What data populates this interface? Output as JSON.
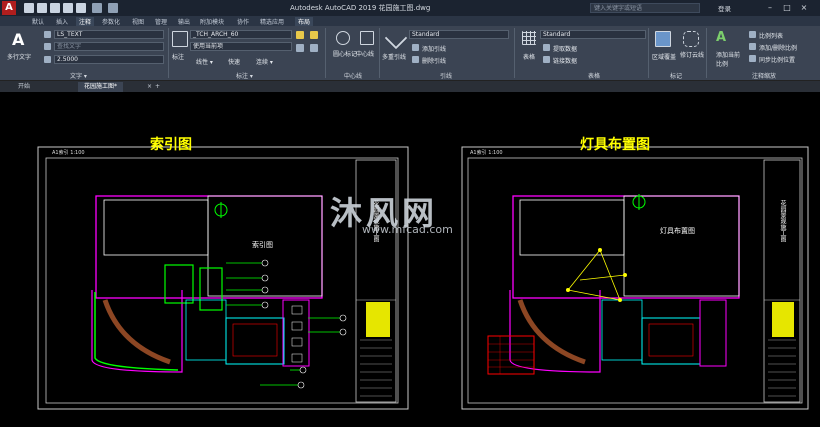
{
  "titlebar": {
    "title": "Autodesk AutoCAD 2019    花园施工图.dwg",
    "search_placeholder": "键入关键字或短语",
    "login": "登录",
    "logo_letter": "A"
  },
  "menu_tabs": [
    "默认",
    "插入",
    "注释",
    "参数化",
    "视图",
    "管理",
    "输出",
    "附加模块",
    "协作",
    "精选应用",
    "布局"
  ],
  "ribbon": {
    "text_panel": {
      "big_button": "多行文字",
      "style_combo": "LS_TEXT",
      "find_placeholder": "查找文字",
      "height_combo": "2.5000",
      "label": "文字 ▾"
    },
    "dim_panel": {
      "big_button": "标注",
      "style_combo": "_TCH_ARCH_60",
      "layer_combo": "使用当前项",
      "tools": [
        "线性 ▾",
        "快速",
        "连续 ▾"
      ],
      "label": "标注 ▾"
    },
    "centerline_panel": {
      "buttons": [
        "圆心标记",
        "中心线"
      ],
      "label": "中心线"
    },
    "leader_panel": {
      "big_button": "多重引线",
      "style_combo": "Standard",
      "tools": [
        "添加引线",
        "删除引线"
      ],
      "label": "引线"
    },
    "table_panel": {
      "big_button": "表格",
      "style_combo": "Standard",
      "tools": [
        "提取数据",
        "链接数据"
      ],
      "label": "表格"
    },
    "markup_panel": {
      "buttons": [
        "区域覆盖",
        "修订云线"
      ],
      "label": "标记"
    },
    "scale_panel": {
      "big_button": "添加当前比例",
      "tools": [
        "比例列表",
        "添加/删除比例",
        "同步比例位置"
      ],
      "label": "注释缩放"
    }
  },
  "doc_tabs": [
    "开始",
    "花园施工图*"
  ],
  "drawing": {
    "left_title": "索引图",
    "right_title": "灯具布置图",
    "left_label": "索引图",
    "right_label": "灯具布置图",
    "left_scale": "A1索引  1:100",
    "right_scale": "A1索引  1:100",
    "side_text": "花园景观施工图"
  },
  "watermark": {
    "text": "沐风网",
    "url": "www.mfcad.com"
  },
  "colors": {
    "titlebar": "#1b2330",
    "ribbon": "#3b4453",
    "canvas": "#000000",
    "title_yellow": "#ffff00",
    "magenta": "#ff00ff",
    "green": "#00ff00",
    "cyan": "#00ffff"
  }
}
